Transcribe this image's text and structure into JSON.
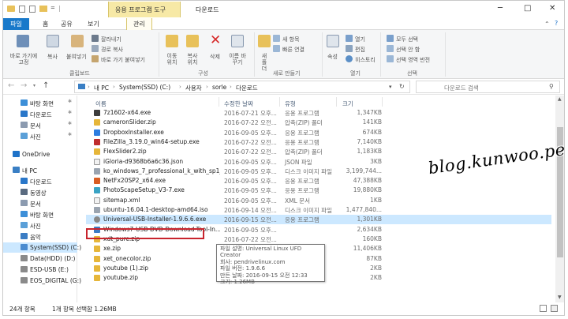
{
  "window": {
    "title": "다운로드",
    "context_tab": "응용 프로그램 도구",
    "controls": [
      "─",
      "□",
      "✕"
    ]
  },
  "ribbon_tabs": [
    "파일",
    "홈",
    "공유",
    "보기",
    "관리"
  ],
  "ribbon": {
    "clipboard": {
      "pin": "바로 가기에 고정",
      "copy": "복사",
      "paste": "붙여넣기",
      "cut": "잘라내기",
      "copy_path": "경로 복사",
      "paste_shortcut": "바로 가기 붙여넣기",
      "group": "클립보드"
    },
    "organize": {
      "move_to": "이동 위치",
      "copy_to": "복사 위치",
      "delete": "삭제",
      "rename": "이름 바꾸기",
      "group": "구성"
    },
    "new": {
      "new_folder": "새 폴더",
      "new_item": "새 항목",
      "easy_access": "빠른 연결",
      "group": "새로 만들기"
    },
    "open": {
      "properties": "속성",
      "open": "열기",
      "edit": "편집",
      "history": "히스토리",
      "group": "열기"
    },
    "select": {
      "select_all": "모두 선택",
      "select_none": "선택 안 함",
      "invert": "선택 영역 반전",
      "group": "선택"
    },
    "help": "?"
  },
  "address": {
    "crumbs": [
      "내 PC",
      "System(SSD) (C:)",
      "사용자",
      "sorle",
      "다운로드"
    ],
    "search_placeholder": "다운로드 검색"
  },
  "nav": [
    {
      "label": "바탕 화면",
      "color": "#3d8fd8",
      "pinned": true
    },
    {
      "label": "다운로드",
      "color": "#2a77c9",
      "pinned": true
    },
    {
      "label": "문서",
      "color": "#8c9bb0",
      "pinned": true
    },
    {
      "label": "사진",
      "color": "#5ba0d8",
      "pinned": true
    },
    {
      "label": "OneDrive",
      "color": "#1e72c8",
      "pinned": false
    },
    {
      "label": "내 PC",
      "color": "#3a7fc4",
      "pinned": false
    },
    {
      "label": "다운로드",
      "color": "#2a77c9",
      "pinned": false
    },
    {
      "label": "동영상",
      "color": "#5a6b80",
      "pinned": false
    },
    {
      "label": "문서",
      "color": "#8c9bb0",
      "pinned": false
    },
    {
      "label": "바탕 화면",
      "color": "#3d8fd8",
      "pinned": false
    },
    {
      "label": "사진",
      "color": "#5ba0d8",
      "pinned": false
    },
    {
      "label": "음악",
      "color": "#3b7dc4",
      "pinned": false
    },
    {
      "label": "System(SSD) (C:)",
      "color": "#4a8bd0",
      "pinned": false
    },
    {
      "label": "Data(HDD) (D:)",
      "color": "#8a8a8a",
      "pinned": false
    },
    {
      "label": "ESD-USB (E:)",
      "color": "#8a8a8a",
      "pinned": false
    },
    {
      "label": "EOS_DIGITAL (G:)",
      "color": "#8a8a8a",
      "pinned": false
    }
  ],
  "columns": {
    "name": "이름",
    "date": "수정한 날짜",
    "type": "유형",
    "size": "크기"
  },
  "files": [
    {
      "name": "7z1602-x64.exe",
      "date": "2016-07-21 오후...",
      "type": "응용 프로그램",
      "size": "1,347KB",
      "color": "#3d3d3d"
    },
    {
      "name": "cameronSlider.zip",
      "date": "2016-07-22 오전...",
      "type": "압축(ZIP) 폴더",
      "size": "141KB",
      "color": "#e6b63a"
    },
    {
      "name": "DropboxInstaller.exe",
      "date": "2016-09-05 오후...",
      "type": "응용 프로그램",
      "size": "674KB",
      "color": "#2d7de0"
    },
    {
      "name": "FileZilla_3.19.0_win64-setup.exe",
      "date": "2016-07-22 오전...",
      "type": "응용 프로그램",
      "size": "7,140KB",
      "color": "#bf2e2e"
    },
    {
      "name": "FlexSlider2.zip",
      "date": "2016-07-22 오전...",
      "type": "압축(ZIP) 폴더",
      "size": "1,183KB",
      "color": "#e6b63a"
    },
    {
      "name": "iGloria-d9368b6a6c36.json",
      "date": "2016-09-05 오후...",
      "type": "JSON 파일",
      "size": "3KB",
      "color": "#f2f2f2"
    },
    {
      "name": "ko_windows_7_professional_k_with_sp1_...",
      "date": "2016-09-05 오후...",
      "type": "디스크 이미지 파일",
      "size": "3,199,744...",
      "color": "#9aa4b0"
    },
    {
      "name": "NetFx20SP2_x64.exe",
      "date": "2016-09-05 오후...",
      "type": "응용 프로그램",
      "size": "47,388KB",
      "color": "#d95d23"
    },
    {
      "name": "PhotoScapeSetup_V3-7.exe",
      "date": "2016-09-05 오후...",
      "type": "응용 프로그램",
      "size": "19,880KB",
      "color": "#3aa3c4"
    },
    {
      "name": "sitemap.xml",
      "date": "2016-09-05 오후...",
      "type": "XML 문서",
      "size": "1KB",
      "color": "#f2f2f2"
    },
    {
      "name": "ubuntu-16.04.1-desktop-amd64.iso",
      "date": "2016-09-14 오전...",
      "type": "디스크 이미지 파일",
      "size": "1,477,840...",
      "color": "#9aa4b0"
    },
    {
      "name": "Universal-USB-Installer-1.9.6.6.exe",
      "date": "2016-09-15 오전...",
      "type": "응용 프로그램",
      "size": "1,301KB",
      "color": "#888",
      "selected": true
    },
    {
      "name": "Windows7-USB-DVD-Download-Tool-In...",
      "date": "2016-09-05 오후...",
      "type": "",
      "size": "2,634KB",
      "color": "#3b7dc4"
    },
    {
      "name": "xdt_pure.zip",
      "date": "2016-07-22 오전...",
      "type": "",
      "size": "160KB",
      "color": "#e6b63a"
    },
    {
      "name": "xe.zip",
      "date": "2016-07-22 오전...",
      "type": "",
      "size": "11,406KB",
      "color": "#e6b63a"
    },
    {
      "name": "xet_onecolor.zip",
      "date": "2016-07-22 오전...",
      "type": "",
      "size": "87KB",
      "color": "#e6b63a"
    },
    {
      "name": "youtube (1).zip",
      "date": "2016-07-22 오전...",
      "type": "압축(ZIP) 폴더",
      "size": "2KB",
      "color": "#e6b63a"
    },
    {
      "name": "youtube.zip",
      "date": "2016-07-22 오전...",
      "type": "압축(ZIP) 폴더",
      "size": "2KB",
      "color": "#e6b63a"
    }
  ],
  "tooltip": {
    "line1": "파일 설명: Universal Linux UFD Creator",
    "line2": "회사: pendrivelinux.com",
    "line3": "파일 버전: 1.9.6.6",
    "line4": "만든 날짜: 2016-09-15 오전 12:33",
    "line5": "크기: 1.26MB"
  },
  "status": {
    "count": "24개 항목",
    "selection": "1개 항목 선택함 1.26MB"
  },
  "watermark": "blog.kunwoo.pe.kr"
}
